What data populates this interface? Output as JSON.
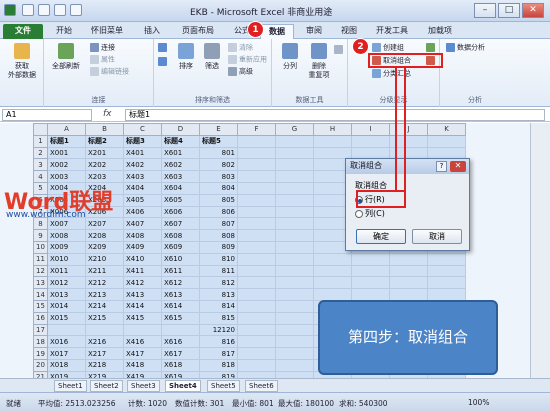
{
  "window": {
    "title": "EKB - Microsoft Excel 非商业用途",
    "minimize": "–",
    "maximize": "□",
    "close": "✕"
  },
  "ribbon_tabs": [
    "文件",
    "开始",
    "怀旧菜单",
    "插入",
    "页面布局",
    "公式",
    "数据",
    "审阅",
    "视图",
    "开发工具",
    "加载项"
  ],
  "ribbon": {
    "get_external": "获取\n外部数据",
    "refresh_all": "全部刷新",
    "connections": "连接",
    "properties": "属性",
    "edit_links": "编辑链接",
    "group_connections": "连接",
    "sort": "排序",
    "filter": "筛选",
    "clear": "清除",
    "reapply": "重新应用",
    "advanced": "高级",
    "group_sort": "排序和筛选",
    "text_to_columns": "分列",
    "remove_duplicates": "删除\n重复项",
    "group_datatools": "数据工具",
    "group_create": "创建组",
    "ungroup": "取消组合",
    "subtotal": "分类汇总",
    "group_outline": "分级显示",
    "data_analysis": "数据分析",
    "group_analysis": "分析"
  },
  "formula_bar": {
    "namebox": "A1",
    "fx": "fx",
    "value": "标题1"
  },
  "sheet": {
    "columns": [
      "A",
      "B",
      "C",
      "D",
      "E",
      "F",
      "G",
      "H",
      "I",
      "J",
      "K"
    ],
    "rows": [
      {
        "n": "1",
        "cells": [
          "标题1",
          "标题2",
          "标题3",
          "标题4",
          "标题5"
        ]
      },
      {
        "n": "2",
        "cells": [
          "X001",
          "X201",
          "X401",
          "X601",
          "801"
        ]
      },
      {
        "n": "3",
        "cells": [
          "X002",
          "X202",
          "X402",
          "X602",
          "802"
        ]
      },
      {
        "n": "4",
        "cells": [
          "X003",
          "X203",
          "X403",
          "X603",
          "803"
        ]
      },
      {
        "n": "5",
        "cells": [
          "X004",
          "X204",
          "X404",
          "X604",
          "804"
        ]
      },
      {
        "n": "6",
        "cells": [
          "X005",
          "X205",
          "X405",
          "X605",
          "805"
        ]
      },
      {
        "n": "7",
        "cells": [
          "X006",
          "X206",
          "X406",
          "X606",
          "806"
        ]
      },
      {
        "n": "8",
        "cells": [
          "X007",
          "X207",
          "X407",
          "X607",
          "807"
        ]
      },
      {
        "n": "9",
        "cells": [
          "X008",
          "X208",
          "X408",
          "X608",
          "808"
        ]
      },
      {
        "n": "10",
        "cells": [
          "X009",
          "X209",
          "X409",
          "X609",
          "809"
        ]
      },
      {
        "n": "11",
        "cells": [
          "X010",
          "X210",
          "X410",
          "X610",
          "810"
        ]
      },
      {
        "n": "12",
        "cells": [
          "X011",
          "X211",
          "X411",
          "X611",
          "811"
        ]
      },
      {
        "n": "13",
        "cells": [
          "X012",
          "X212",
          "X412",
          "X612",
          "812"
        ]
      },
      {
        "n": "14",
        "cells": [
          "X013",
          "X213",
          "X413",
          "X613",
          "813"
        ]
      },
      {
        "n": "15",
        "cells": [
          "X014",
          "X214",
          "X414",
          "X614",
          "814"
        ]
      },
      {
        "n": "16",
        "cells": [
          "X015",
          "X215",
          "X415",
          "X615",
          "815"
        ]
      },
      {
        "n": "17",
        "cells": [
          "",
          "",
          "",
          "",
          "12120"
        ]
      },
      {
        "n": "18",
        "cells": [
          "X016",
          "X216",
          "X416",
          "X616",
          "816"
        ]
      },
      {
        "n": "19",
        "cells": [
          "X017",
          "X217",
          "X417",
          "X617",
          "817"
        ]
      },
      {
        "n": "20",
        "cells": [
          "X018",
          "X218",
          "X418",
          "X618",
          "818"
        ]
      },
      {
        "n": "21",
        "cells": [
          "X019",
          "X219",
          "X419",
          "X619",
          "819"
        ]
      }
    ]
  },
  "outline_levels": [
    "1",
    "2",
    "3"
  ],
  "sheet_tabs": [
    "Sheet1",
    "Sheet2",
    "Sheet3",
    "Sheet4",
    "Sheet5",
    "Sheet6"
  ],
  "status": {
    "mode": "就绪",
    "average": "平均值: 2513.023256",
    "count": "计数: 1020",
    "numcount": "数值计数: 301",
    "min": "最小值: 801",
    "max": "最大值: 180100",
    "sum": "求和: 540300",
    "zoom": "100%"
  },
  "dialog": {
    "title": "取消组合",
    "help": "?",
    "close": "✕",
    "section": "取消组合",
    "opt_row": "行(R)",
    "opt_col": "列(C)",
    "ok": "确定",
    "cancel": "取消"
  },
  "annotations": {
    "step1": "1",
    "step2": "2",
    "banner": "第四步：取消组合"
  },
  "watermark": {
    "logo": "Word联盟",
    "url": "www.wordlm.com"
  }
}
